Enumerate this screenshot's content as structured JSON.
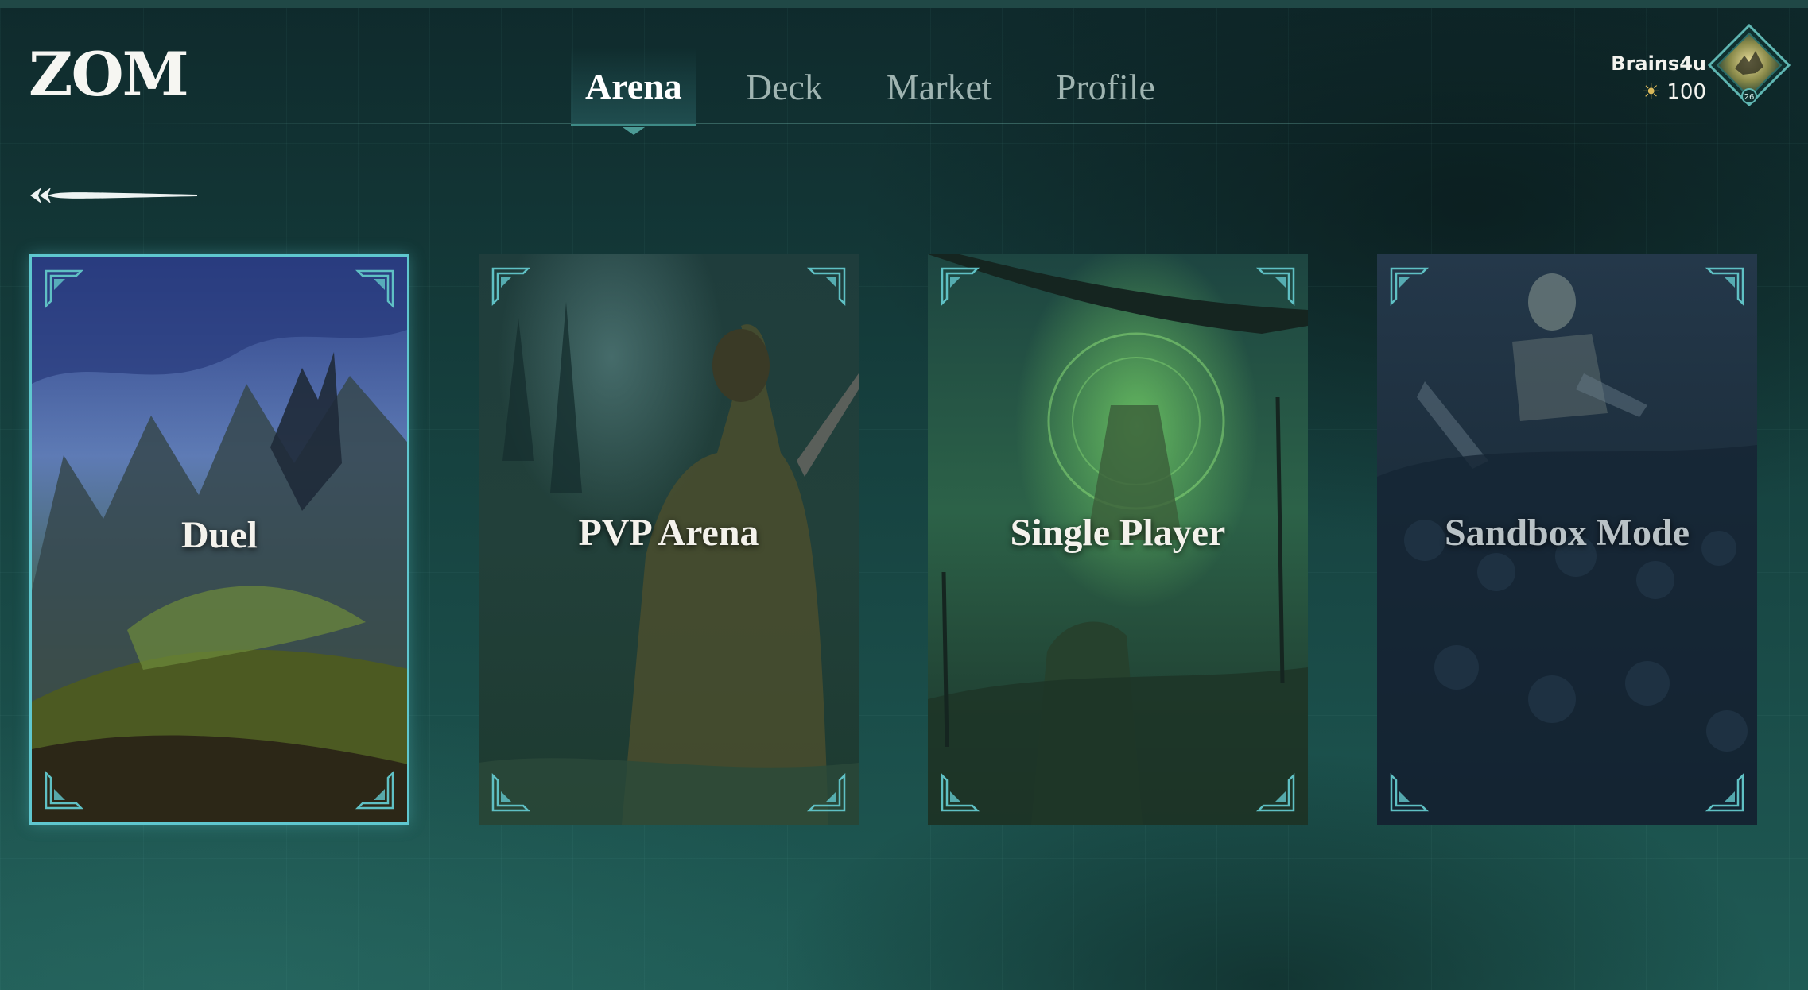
{
  "app": {
    "logo": "ZOM"
  },
  "nav": {
    "tabs": [
      {
        "label": "Arena",
        "active": true
      },
      {
        "label": "Deck",
        "active": false
      },
      {
        "label": "Market",
        "active": false
      },
      {
        "label": "Profile",
        "active": false
      }
    ]
  },
  "user": {
    "name": "Brains4u",
    "currency_icon": "sun-icon",
    "currency": "100",
    "level": "26"
  },
  "back": {
    "icon": "back-arrow-icon"
  },
  "modes": [
    {
      "label": "Duel",
      "selected": true
    },
    {
      "label": "PVP Arena",
      "selected": false
    },
    {
      "label": "Single Player",
      "selected": false
    },
    {
      "label": "Sandbox Mode",
      "selected": false
    }
  ],
  "colors": {
    "accent": "#5fc7cf",
    "currency": "#d9b85a",
    "background": "#16413f"
  }
}
